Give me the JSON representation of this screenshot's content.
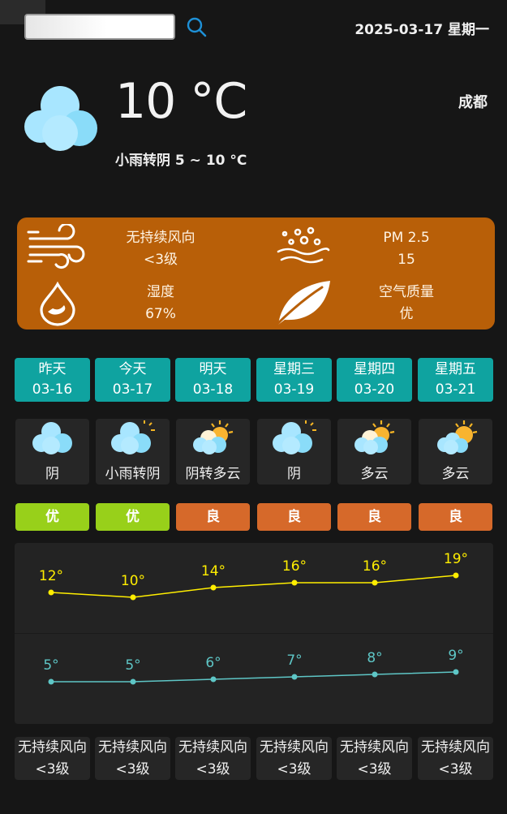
{
  "header": {
    "search_placeholder": "",
    "date": "2025-03-17 星期一"
  },
  "current": {
    "temp": "10 °C",
    "summary": "小雨转阴  5 ~ 10 °C",
    "city": "成都",
    "icon": "cloud-icon"
  },
  "info": {
    "wind_title": "无持续风向",
    "wind_level": "<3级",
    "pm_title": "PM 2.5",
    "pm_value": "15",
    "humidity_title": "湿度",
    "humidity_value": "67%",
    "air_title": "空气质量",
    "air_value": "优"
  },
  "days": [
    {
      "name": "昨天",
      "date": "03-16",
      "weather": "阴",
      "icon": "cloud-icon",
      "aqi": "优",
      "aqi_color": "#98d01a",
      "high": 12,
      "low": 5,
      "high_label": "12°",
      "low_label": "5°",
      "wind": "无持续风向",
      "wind_level": "<3级"
    },
    {
      "name": "今天",
      "date": "03-17",
      "weather": "小雨转阴",
      "icon": "cloud-sun-icon",
      "aqi": "优",
      "aqi_color": "#98d01a",
      "high": 10,
      "low": 5,
      "high_label": "10°",
      "low_label": "5°",
      "wind": "无持续风向",
      "wind_level": "<3级"
    },
    {
      "name": "明天",
      "date": "03-18",
      "weather": "阴转多云",
      "icon": "partly-cloudy-icon",
      "aqi": "良",
      "aqi_color": "#d6692a",
      "high": 14,
      "low": 6,
      "high_label": "14°",
      "low_label": "6°",
      "wind": "无持续风向",
      "wind_level": "<3级"
    },
    {
      "name": "星期三",
      "date": "03-19",
      "weather": "阴",
      "icon": "cloud-sun-icon",
      "aqi": "良",
      "aqi_color": "#d6692a",
      "high": 16,
      "low": 7,
      "high_label": "16°",
      "low_label": "7°",
      "wind": "无持续风向",
      "wind_level": "<3级"
    },
    {
      "name": "星期四",
      "date": "03-20",
      "weather": "多云",
      "icon": "partly-cloudy-icon",
      "aqi": "良",
      "aqi_color": "#d6692a",
      "high": 16,
      "low": 8,
      "high_label": "16°",
      "low_label": "8°",
      "wind": "无持续风向",
      "wind_level": "<3级"
    },
    {
      "name": "星期五",
      "date": "03-21",
      "weather": "多云",
      "icon": "sun-cloud-icon",
      "aqi": "良",
      "aqi_color": "#d6692a",
      "high": 19,
      "low": 9,
      "high_label": "19°",
      "low_label": "9°",
      "wind": "无持续风向",
      "wind_level": "<3级"
    }
  ],
  "chart_data": {
    "type": "line",
    "categories": [
      "03-16",
      "03-17",
      "03-18",
      "03-19",
      "03-20",
      "03-21"
    ],
    "series": [
      {
        "values": [
          12,
          10,
          14,
          16,
          16,
          19
        ],
        "color": "#ffee00"
      },
      {
        "values": [
          5,
          5,
          6,
          7,
          8,
          9
        ],
        "color": "#5ec6c6"
      }
    ]
  },
  "colors": {
    "accent_teal": "#0fa3a0",
    "panel_orange": "#b85f08",
    "aqi_good": "#98d01a",
    "aqi_moderate": "#d6692a",
    "high_line": "#ffee00",
    "low_line": "#5ec6c6",
    "search_icon": "#1e90d6"
  }
}
